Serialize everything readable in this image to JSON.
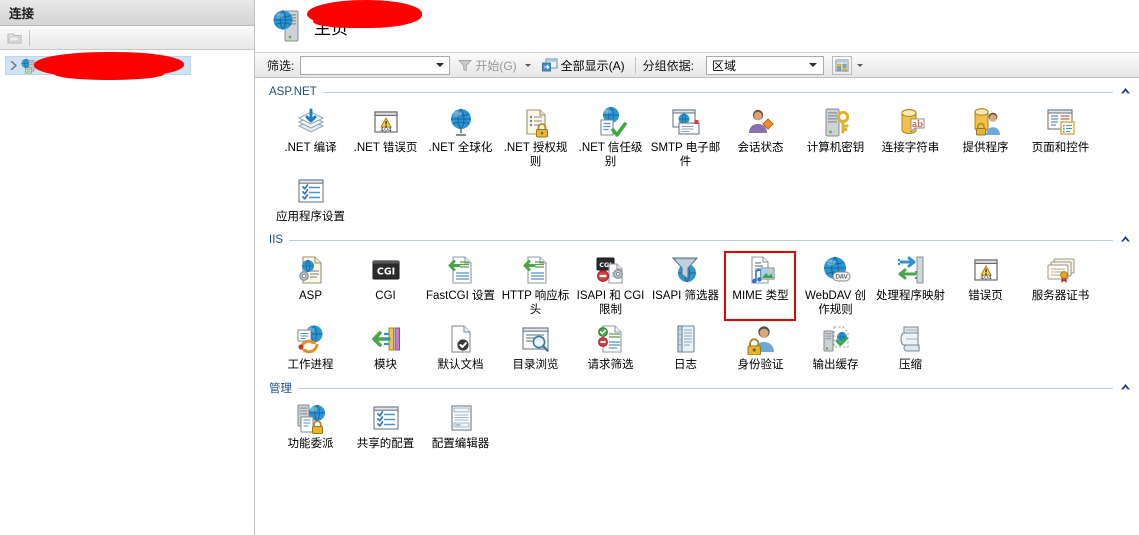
{
  "left_pane": {
    "header": "连接",
    "toolbar": {
      "connect_icon": "connect-to-server-icon"
    },
    "tree": {
      "item_label": "",
      "item_redacted": true,
      "expander": "▶",
      "icon": "server-node-icon"
    }
  },
  "title": {
    "icon": "web-server-icon",
    "redacted_name": "",
    "suffix": "主页"
  },
  "filter_bar": {
    "filter_label": "筛选:",
    "filter_value": "",
    "go_label": "开始(G)",
    "go_icon": "funnel-icon",
    "show_all_label": "全部显示(A)",
    "show_all_icon": "show-all-icon",
    "group_by_label": "分组依据:",
    "group_by_value": "区域",
    "view_icon": "view-mode-icon"
  },
  "sections": [
    {
      "title": "ASP.NET",
      "items": [
        {
          "label": ".NET 编译",
          "icon": "net-compilation-icon"
        },
        {
          "label": ".NET 错误页",
          "icon": "net-error-pages-icon"
        },
        {
          "label": ".NET 全球化",
          "icon": "net-globalization-icon"
        },
        {
          "label": ".NET 授权规则",
          "icon": "net-authorization-rules-icon"
        },
        {
          "label": ".NET 信任级别",
          "icon": "net-trust-levels-icon"
        },
        {
          "label": "SMTP 电子邮件",
          "icon": "smtp-email-icon"
        },
        {
          "label": "会话状态",
          "icon": "session-state-icon"
        },
        {
          "label": "计算机密钥",
          "icon": "machine-key-icon"
        },
        {
          "label": "连接字符串",
          "icon": "connection-strings-icon"
        },
        {
          "label": "提供程序",
          "icon": "providers-icon"
        },
        {
          "label": "页面和控件",
          "icon": "pages-and-controls-icon"
        },
        {
          "label": "应用程序设置",
          "icon": "application-settings-icon"
        }
      ]
    },
    {
      "title": "IIS",
      "items": [
        {
          "label": "ASP",
          "icon": "asp-icon"
        },
        {
          "label": "CGI",
          "icon": "cgi-icon"
        },
        {
          "label": "FastCGI 设置",
          "icon": "fastcgi-settings-icon"
        },
        {
          "label": "HTTP 响应标头",
          "icon": "http-response-headers-icon"
        },
        {
          "label": "ISAPI 和 CGI 限制",
          "icon": "isapi-cgi-restrictions-icon"
        },
        {
          "label": "ISAPI 筛选器",
          "icon": "isapi-filters-icon"
        },
        {
          "label": "MIME 类型",
          "icon": "mime-types-icon",
          "selected": true
        },
        {
          "label": "WebDAV 创作规则",
          "icon": "webdav-authoring-rules-icon"
        },
        {
          "label": "处理程序映射",
          "icon": "handler-mappings-icon"
        },
        {
          "label": "错误页",
          "icon": "error-pages-icon"
        },
        {
          "label": "服务器证书",
          "icon": "server-certificates-icon"
        },
        {
          "label": "工作进程",
          "icon": "worker-processes-icon"
        },
        {
          "label": "模块",
          "icon": "modules-icon"
        },
        {
          "label": "默认文档",
          "icon": "default-document-icon"
        },
        {
          "label": "目录浏览",
          "icon": "directory-browsing-icon"
        },
        {
          "label": "请求筛选",
          "icon": "request-filtering-icon"
        },
        {
          "label": "日志",
          "icon": "logging-icon"
        },
        {
          "label": "身份验证",
          "icon": "authentication-icon"
        },
        {
          "label": "输出缓存",
          "icon": "output-caching-icon"
        },
        {
          "label": "压缩",
          "icon": "compression-icon"
        }
      ]
    },
    {
      "title": "管理",
      "items": [
        {
          "label": "功能委派",
          "icon": "feature-delegation-icon"
        },
        {
          "label": "共享的配置",
          "icon": "shared-configuration-icon"
        },
        {
          "label": "配置编辑器",
          "icon": "configuration-editor-icon"
        }
      ]
    }
  ],
  "colors": {
    "section_title": "#1f4f82",
    "selection_outline": "#e60000",
    "tree_selection": "#cfe3f5",
    "redaction": "#ff0000"
  }
}
